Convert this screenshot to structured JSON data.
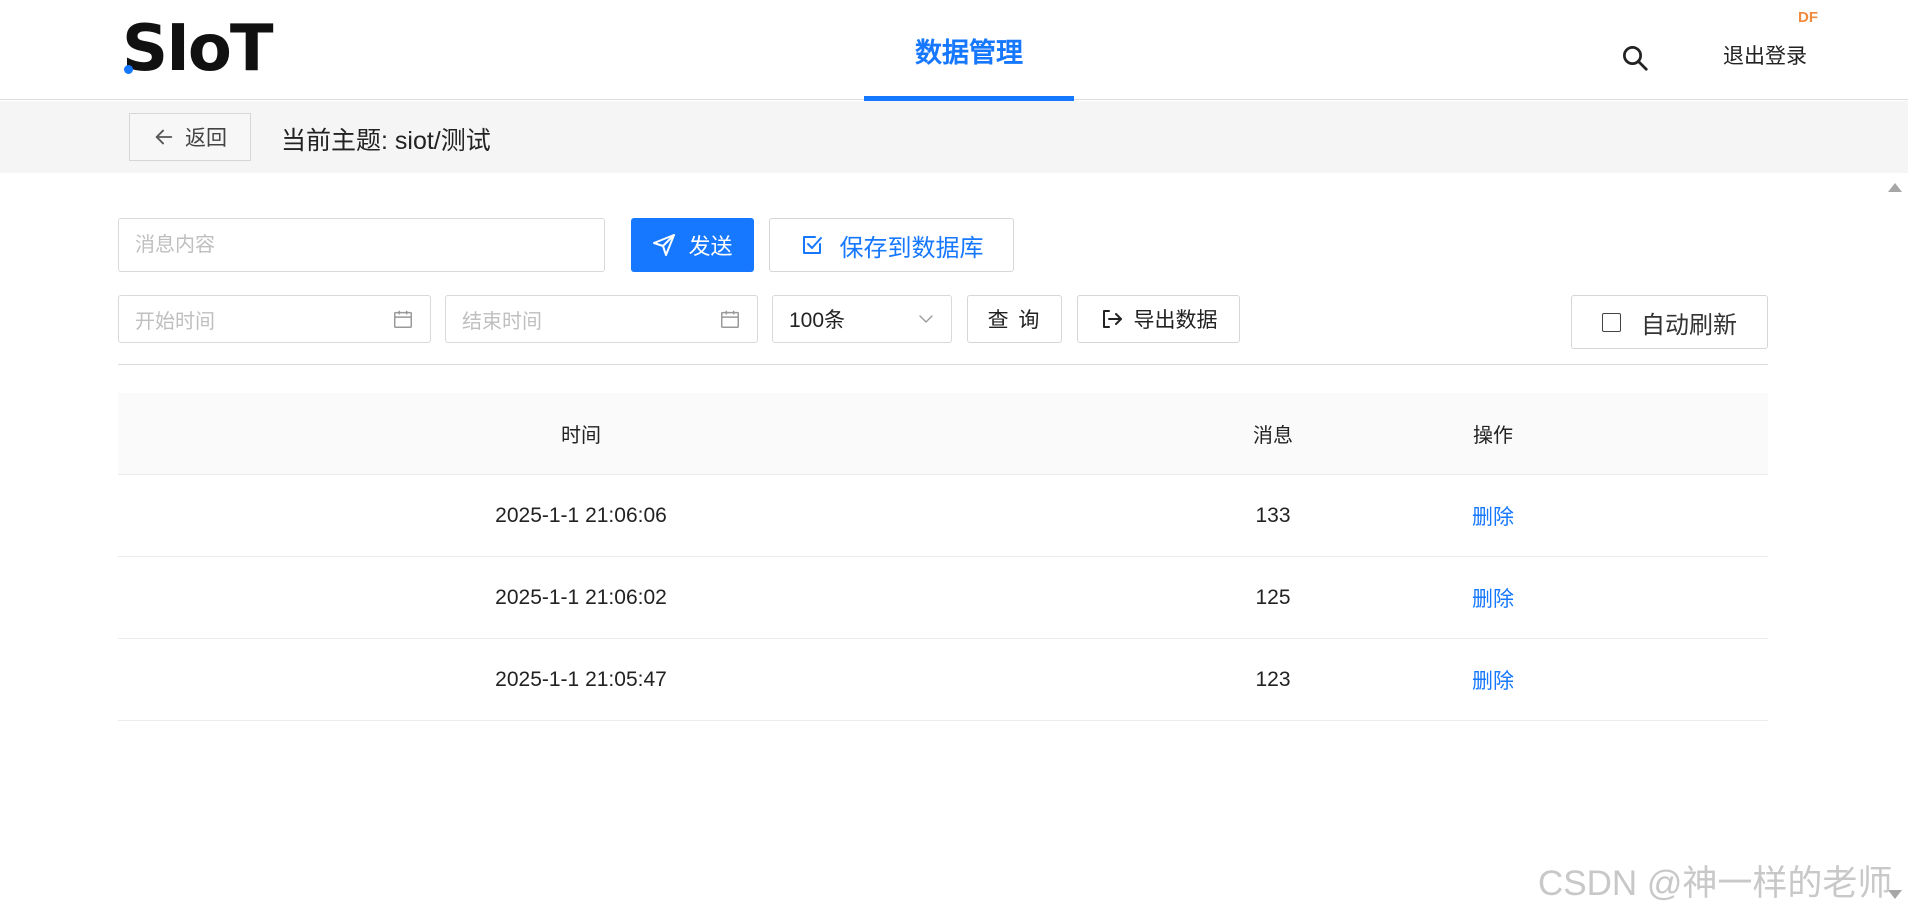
{
  "header": {
    "logo_text": "SIoT",
    "nav_tab_label": "数据管理",
    "logout_label": "退出登录",
    "badge_text": "DF",
    "accent_color": "#1677ff"
  },
  "subbar": {
    "back_label": "返回",
    "topic_label": "当前主题: siot/测试"
  },
  "toolbar": {
    "message_placeholder": "消息内容",
    "send_label": "发送",
    "save_label": "保存到数据库",
    "start_time_placeholder": "开始时间",
    "end_time_placeholder": "结束时间",
    "count_selected": "100条",
    "query_label": "查 询",
    "export_label": "导出数据",
    "auto_refresh_label": "自动刷新",
    "auto_refresh_checked": false
  },
  "table": {
    "columns": [
      "时间",
      "消息",
      "操作"
    ],
    "rows": [
      {
        "time": "2025-1-1 21:06:06",
        "message": "133",
        "action": "删除"
      },
      {
        "time": "2025-1-1 21:06:02",
        "message": "125",
        "action": "删除"
      },
      {
        "time": "2025-1-1 21:05:47",
        "message": "123",
        "action": "删除"
      }
    ]
  },
  "watermark": "CSDN @神一样的老师",
  "icons": {
    "search": "search-icon",
    "back": "arrow-left-icon",
    "send": "paper-plane-icon",
    "save": "check-square-icon",
    "calendar": "calendar-icon",
    "dropdown": "chevron-down-icon",
    "export": "export-icon"
  }
}
